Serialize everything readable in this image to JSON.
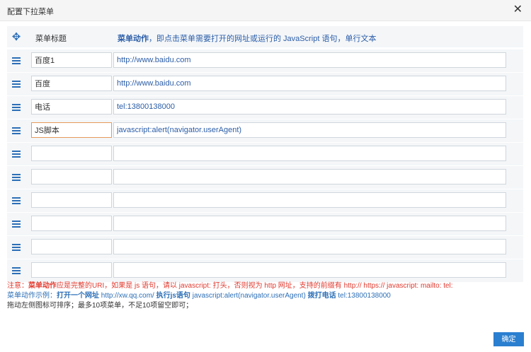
{
  "dialog": {
    "title": "配置下拉菜单",
    "close_glyph": "✕",
    "confirm_label": "确定"
  },
  "header": {
    "title_label": "菜单标题",
    "action_bold": "菜单动作",
    "action_rest": "，即点击菜单需要打开的网址或运行的 JavaScript 语句，单行文本"
  },
  "rows": [
    {
      "title": "百度1",
      "action": "http://www.baidu.com"
    },
    {
      "title": "百度",
      "action": "http://www.baidu.com"
    },
    {
      "title": "电话",
      "action": "tel:13800138000"
    },
    {
      "title": "JS脚本",
      "action": "javascript:alert(navigator.userAgent)"
    },
    {
      "title": "",
      "action": ""
    },
    {
      "title": "",
      "action": ""
    },
    {
      "title": "",
      "action": ""
    },
    {
      "title": "",
      "action": ""
    },
    {
      "title": "",
      "action": ""
    },
    {
      "title": "",
      "action": ""
    }
  ],
  "notes": {
    "line1_prefix": "注意：",
    "line1_bold": "菜单动作",
    "line1_rest": "应是完整的URI，如果是 js 语句，请以 javascript: 打头，否则视为 http 网址，支持的前缀有 http://   https://   javascript:   mailto:   tel:",
    "line2_prefix": "菜单动作示例：",
    "ex1_label": "打开一个网址",
    "ex1_value": " http://xw.qq.com/  ",
    "ex2_label": "执行js语句",
    "ex2_value": " javascript:alert(navigator.userAgent)  ",
    "ex3_label": "拨打电话",
    "ex3_value": " tel:13800138000",
    "line3": "拖动左侧图标可排序；最多10项菜单，不足10项留空即可；"
  },
  "colors": {
    "accent": "#2c6fb7",
    "warning": "#e03a2f",
    "button": "#2b7fd0",
    "focus_border": "#e69a5b"
  },
  "icons": {
    "header_handle": "move-arrows-icon",
    "row_handle": "drag-handle-icon"
  }
}
